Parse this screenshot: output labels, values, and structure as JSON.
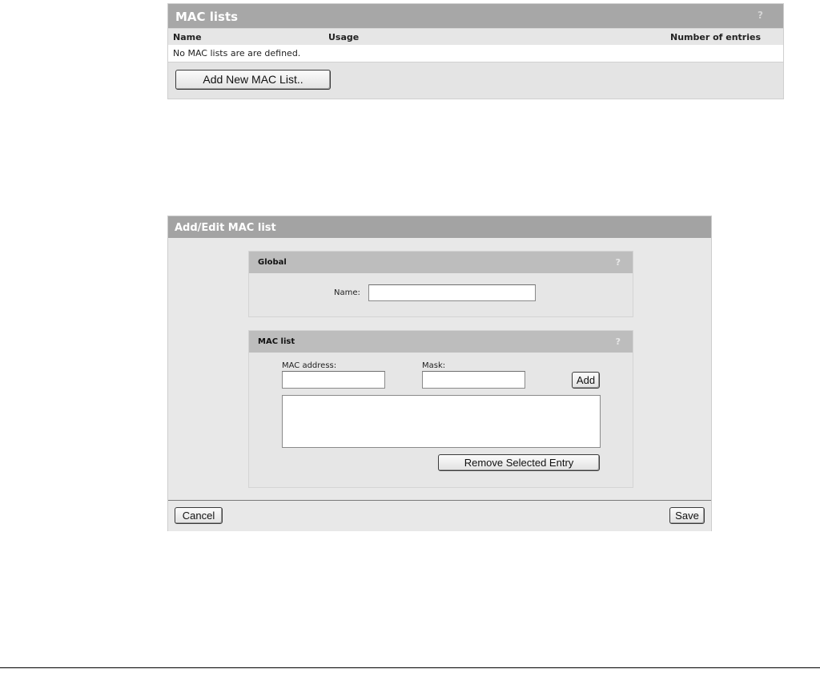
{
  "mac_lists": {
    "title": "MAC lists",
    "help": "?",
    "columns": {
      "name": "Name",
      "usage": "Usage",
      "entries": "Number of entries"
    },
    "empty_message": "No MAC lists are are defined.",
    "add_button": "Add New MAC List.."
  },
  "dialog": {
    "title": "Add/Edit MAC list",
    "global": {
      "title": "Global",
      "help": "?",
      "name_label": "Name:",
      "name_value": ""
    },
    "mac_list": {
      "title": "MAC list",
      "help": "?",
      "mac_address_label": "MAC address:",
      "mac_address_value": "",
      "mask_label": "Mask:",
      "mask_value": "",
      "add_button": "Add",
      "entries": [],
      "remove_button": "Remove Selected Entry"
    },
    "cancel_button": "Cancel",
    "save_button": "Save"
  }
}
